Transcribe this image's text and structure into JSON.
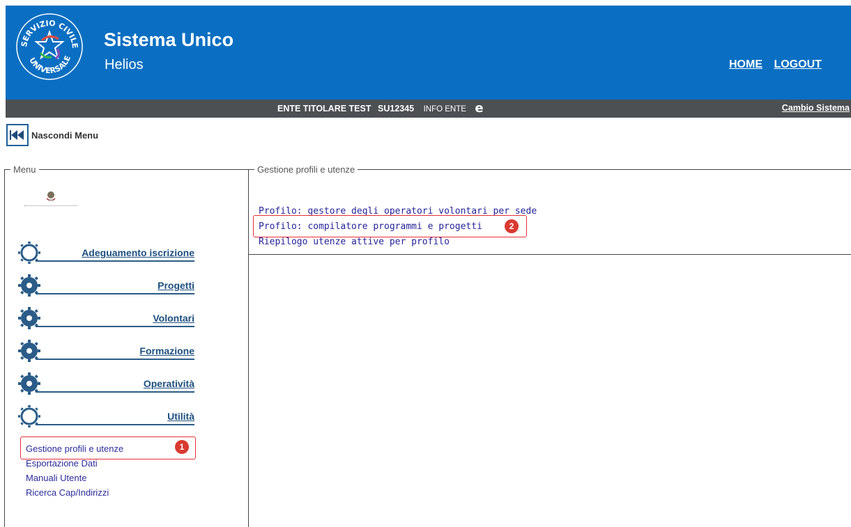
{
  "header": {
    "title": "Sistema Unico",
    "subtitle": "Helios",
    "logo_text": "SERVIZIO CIVILE UNIVERSALE",
    "links": [
      {
        "label": "HOME"
      },
      {
        "label": "LOGOUT"
      }
    ],
    "background": "#0a6fc2"
  },
  "infobar": {
    "ente_name": "ENTE TITOLARE TEST",
    "ente_code": "SU12345",
    "info_ente": "INFO ENTE",
    "e_icon": "e",
    "cambio": "Cambio Sistema"
  },
  "hide_menu": {
    "label": "Nascondi Menu",
    "icon": "rewind-icon"
  },
  "menu": {
    "legend": "Menu",
    "items": [
      {
        "label": "Adeguamento iscrizione",
        "icon": "gear-outline-icon"
      },
      {
        "label": "Progetti",
        "icon": "gear-icon"
      },
      {
        "label": "Volontari",
        "icon": "gear-icon"
      },
      {
        "label": "Formazione",
        "icon": "gear-icon"
      },
      {
        "label": "Operatività",
        "icon": "gear-icon"
      },
      {
        "label": "Utilità",
        "icon": "gear-outline-icon"
      }
    ],
    "sub_links": [
      {
        "label": "Gestione profili e utenze"
      },
      {
        "label": "Esportazione Dati"
      },
      {
        "label": "Manuali Utente"
      },
      {
        "label": "Ricerca Cap/Indirizzi"
      }
    ]
  },
  "gestione": {
    "legend": "Gestione profili e utenze",
    "links": [
      {
        "label": "Profilo: gestore degli operatori volontari per sede"
      },
      {
        "label": "Profilo: compilatore programmi e progetti"
      },
      {
        "label": "Riepilogo utenze attive per profilo"
      }
    ]
  },
  "annotations": {
    "step1": "1",
    "step2": "2",
    "color": "#e53035"
  }
}
